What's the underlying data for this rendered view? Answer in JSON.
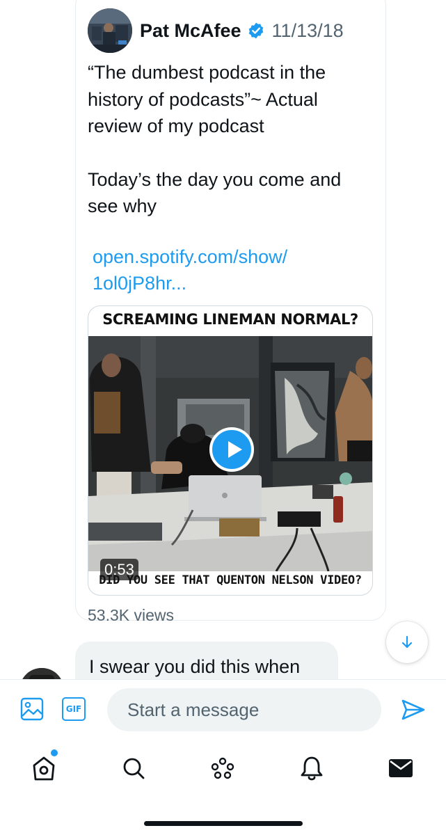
{
  "tweet": {
    "author_name": "Pat McAfee",
    "date": "11/13/18",
    "text_lines": [
      "“The dumbest podcast in the",
      "history of podcasts”~ Actual",
      "review of my podcast",
      "Today’s the day you come and",
      "see why"
    ],
    "link_line_1": "open.spotify.com/show/",
    "link_line_2": "1ol0jP8hr...",
    "media": {
      "title": "SCREAMING LINEMAN NORMAL?",
      "duration": "0:53",
      "caption": "DID YOU SEE THAT QUENTON NELSON VIDEO?"
    },
    "views": "53.3K views"
  },
  "reply": {
    "text": "I swear you did this when"
  },
  "composer": {
    "placeholder": "Start a message",
    "gif_label": "GIF"
  },
  "icons": {
    "verified": "verified-badge-icon",
    "scroll": "arrow-down-icon",
    "image": "image-icon",
    "gif": "gif-icon",
    "send": "send-icon",
    "home": "home-icon",
    "search": "search-icon",
    "spaces": "spaces-icon",
    "notifications": "bell-icon",
    "messages": "mail-icon"
  },
  "colors": {
    "accent": "#1d9bf0",
    "text": "#0f1419",
    "secondary": "#536471",
    "bubble": "#eff3f4"
  }
}
